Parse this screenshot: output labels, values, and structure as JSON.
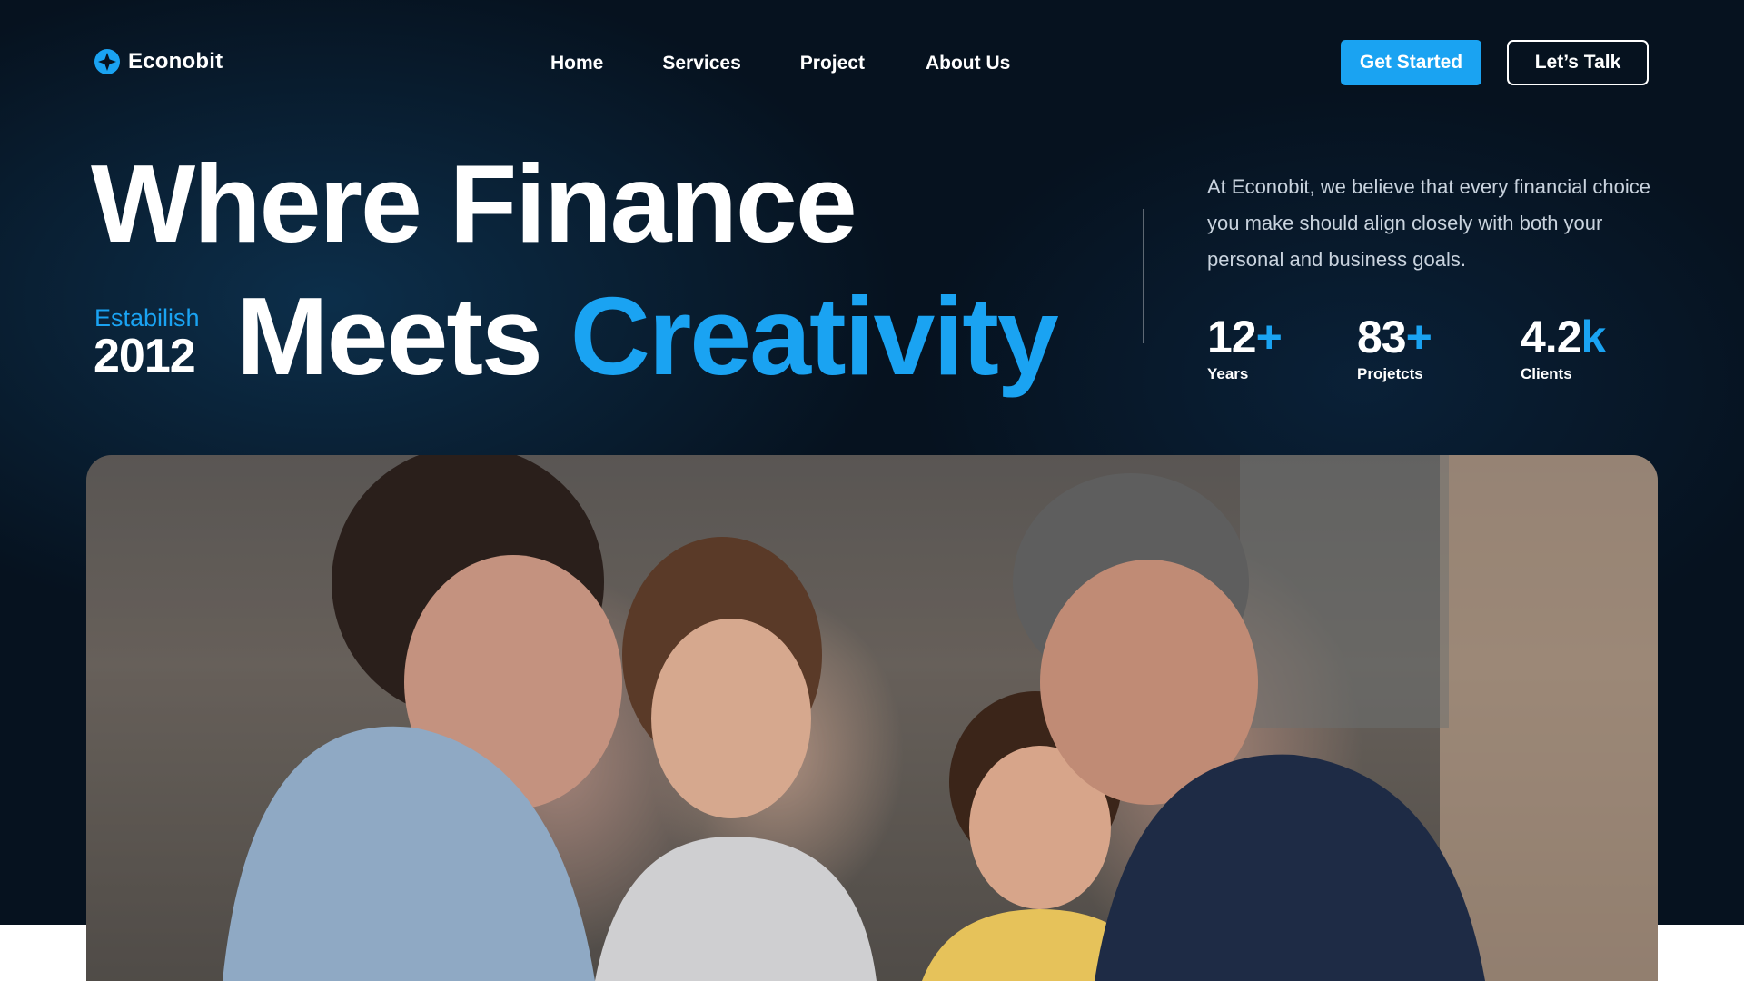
{
  "brand": {
    "name": "Econobit",
    "color": "#1aa3f2"
  },
  "nav": {
    "items": [
      "Home",
      "Services",
      "Project",
      "About Us"
    ]
  },
  "actions": {
    "get_started": "Get Started",
    "lets_talk": "Let’s Talk"
  },
  "hero": {
    "line1": "Where Finance",
    "line2_plain": "Meets",
    "line2_accent": "Creativity",
    "established_label": "Estabilish",
    "established_year": "2012",
    "intro": "At Econobit, we believe that every financial choice you make should align closely with both your personal and business goals."
  },
  "stats": [
    {
      "value": "12",
      "suffix": "+",
      "label": "Years"
    },
    {
      "value": "83",
      "suffix": "+",
      "label": "Projetcts"
    },
    {
      "value": "4.2",
      "suffix": "k",
      "label": "Clients"
    }
  ],
  "icons": {
    "logo": "star-badge-icon"
  },
  "colors": {
    "background": "#06121f",
    "accent": "#1aa3f2",
    "text": "#ffffff",
    "muted_text": "#c9d3de"
  }
}
